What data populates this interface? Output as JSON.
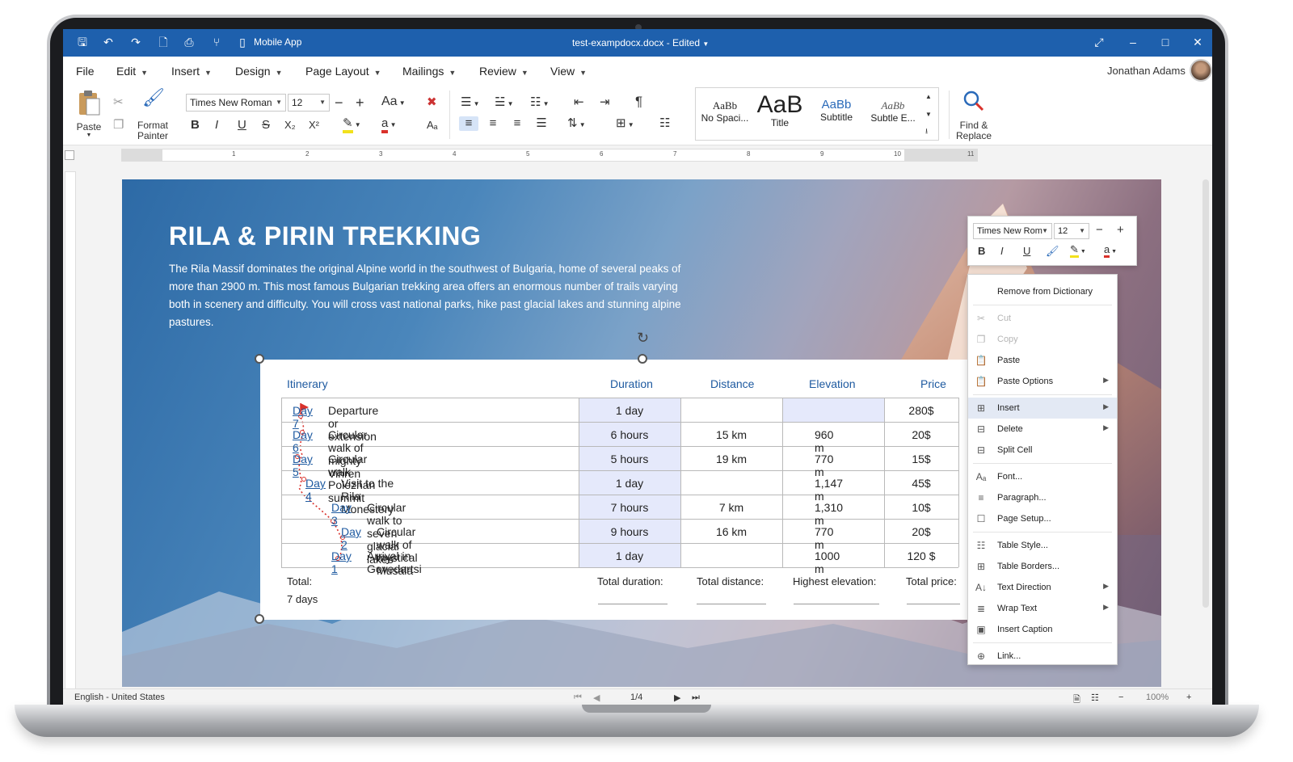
{
  "window": {
    "title": "test-exampdocx.docx - Edited",
    "mobile_app_label": "Mobile App"
  },
  "menu": {
    "items": [
      "File",
      "Edit",
      "Insert",
      "Design",
      "Page Layout",
      "Mailings",
      "Review",
      "View"
    ],
    "user_name": "Jonathan Adams"
  },
  "ribbon": {
    "paste_label": "Paste",
    "format_painter_line1": "Format",
    "format_painter_line2": "Painter",
    "font_name": "Times New Roman",
    "font_size": "12",
    "change_case": "Aa",
    "find_replace_line1": "Find &",
    "find_replace_line2": "Replace",
    "styles": [
      {
        "sample": "AaBb",
        "name": "No Spaci..."
      },
      {
        "sample": "AaB",
        "name": "Title"
      },
      {
        "sample": "AaBb",
        "name": "Subtitle"
      },
      {
        "sample": "AaBb",
        "name": "Subtle E..."
      }
    ]
  },
  "ruler": {
    "numbers": [
      "1",
      "2",
      "3",
      "4",
      "5",
      "6",
      "7",
      "8",
      "9",
      "10",
      "11"
    ]
  },
  "document": {
    "title": "RILA & PIRIN TREKKING",
    "paragraph": "The Rila Massif dominates the original Alpine world in the southwest of Bulgaria, home of several peaks of more than 2900 m. This most famous Bulgarian trekking area offers an enormous number of trails varying both in scenery and difficulty. You will cross vast national parks, hike past glacial lakes and stunning alpine pastures.",
    "table": {
      "headers": [
        "Itinerary",
        "Duration",
        "Distance",
        "Elevation",
        "Price"
      ],
      "rows": [
        {
          "day": "Day 7",
          "desc": "Departure or extension",
          "duration": "1 day",
          "distance": "",
          "elevation": "",
          "price": "280$"
        },
        {
          "day": "Day 6",
          "desc": "Circular walk of mighty Vihren",
          "duration": "6 hours",
          "distance": "15 km",
          "elevation": "960 m",
          "price": "20$"
        },
        {
          "day": "Day 5",
          "desc": "Circular walk Polezhan summit",
          "duration": "5 hours",
          "distance": "19 km",
          "elevation": "770 m",
          "price": "15$"
        },
        {
          "day": "Day 4",
          "desc": "Visit to the Rila Monestery",
          "duration": "1 day",
          "distance": "",
          "elevation": "1,147 m",
          "price": "45$"
        },
        {
          "day": "Day 3",
          "desc": "Circular walk to seven glacial lakes",
          "duration": "7 hours",
          "distance": "7 km",
          "elevation": "1,310 m",
          "price": "10$"
        },
        {
          "day": "Day 2",
          "desc": "Circular walk of mystical Musala",
          "duration": "9 hours",
          "distance": "16 km",
          "elevation": "770 m",
          "price": "20$"
        },
        {
          "day": "Day 1",
          "desc": "Arrival in Govedartsi",
          "duration": "1 day",
          "distance": "",
          "elevation": "1000 m",
          "price": "120 $"
        }
      ],
      "totals": {
        "label": "Total:",
        "days": "7 days",
        "duration": "Total duration:",
        "distance": "Total distance:",
        "elevation": "Highest elevation:",
        "price": "Total price:"
      }
    }
  },
  "mini_toolbar": {
    "font_name": "Times New Rom",
    "font_size": "12"
  },
  "context_menu": {
    "items": [
      {
        "label": "Remove from Dictionary",
        "icon": "none",
        "enabled": true
      },
      {
        "label": "Cut",
        "icon": "scissors-icon",
        "enabled": false
      },
      {
        "label": "Copy",
        "icon": "copy-icon",
        "enabled": false
      },
      {
        "label": "Paste",
        "icon": "paste-icon",
        "enabled": true
      },
      {
        "label": "Paste Options",
        "icon": "paste-options-icon",
        "enabled": true,
        "submenu": true
      },
      {
        "label": "Insert",
        "icon": "insert-table-icon",
        "enabled": true,
        "submenu": true,
        "active": true
      },
      {
        "label": "Delete",
        "icon": "delete-table-icon",
        "enabled": true,
        "submenu": true
      },
      {
        "label": "Split Cell",
        "icon": "split-cell-icon",
        "enabled": true
      },
      {
        "label": "Font...",
        "icon": "font-icon",
        "enabled": true
      },
      {
        "label": "Paragraph...",
        "icon": "paragraph-icon",
        "enabled": true
      },
      {
        "label": "Page Setup...",
        "icon": "page-setup-icon",
        "enabled": true
      },
      {
        "label": "Table Style...",
        "icon": "table-style-icon",
        "enabled": true
      },
      {
        "label": "Table Borders...",
        "icon": "table-borders-icon",
        "enabled": true
      },
      {
        "label": "Text Direction",
        "icon": "text-direction-icon",
        "enabled": true,
        "submenu": true
      },
      {
        "label": "Wrap Text",
        "icon": "wrap-text-icon",
        "enabled": true,
        "submenu": true
      },
      {
        "label": "Insert Caption",
        "icon": "insert-caption-icon",
        "enabled": true
      },
      {
        "label": "Link...",
        "icon": "link-icon",
        "enabled": true
      }
    ]
  },
  "status_bar": {
    "language": "English - United States",
    "page_indicator": "1/4",
    "zoom": "100%"
  },
  "colors": {
    "titlebar": "#1e60ad",
    "link": "#1e5aa0",
    "duration_column": "#e5e9fb",
    "route_marker": "#d9312b"
  }
}
